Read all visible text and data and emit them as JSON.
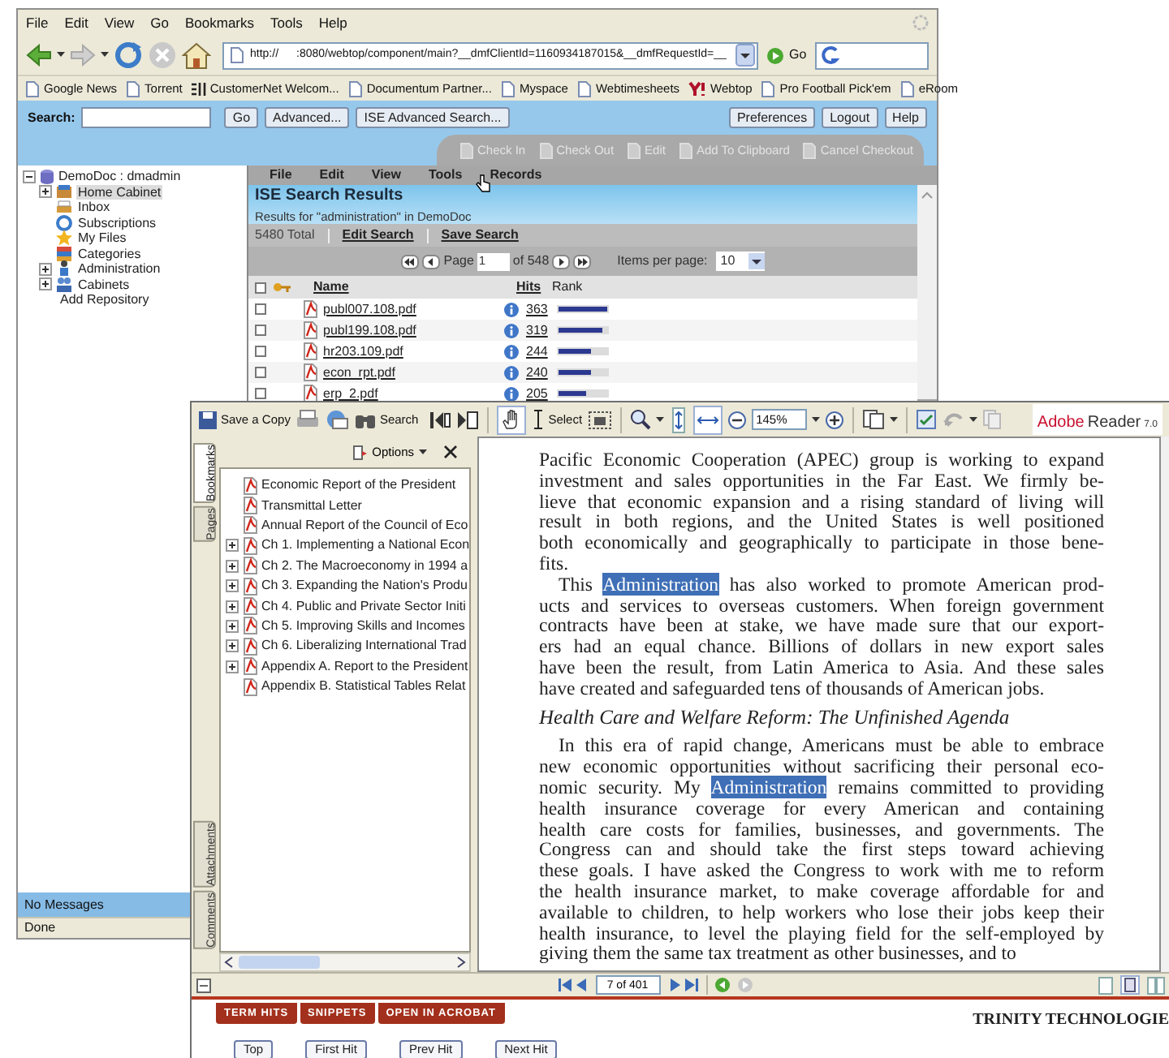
{
  "browser": {
    "menu": [
      "File",
      "Edit",
      "View",
      "Go",
      "Bookmarks",
      "Tools",
      "Help"
    ],
    "address": {
      "prefix": "http://",
      "value": ":8080/webtop/component/main?__dmfClientId=1160934187015&__dmfRequestId=__"
    },
    "go_button": "Go",
    "bookmarks": [
      {
        "label": "Google News",
        "kind": "page"
      },
      {
        "label": "Torrent",
        "kind": "page"
      },
      {
        "label": "CustomerNet Welcom...",
        "kind": "emc"
      },
      {
        "label": "Documentum Partner...",
        "kind": "page"
      },
      {
        "label": "Myspace",
        "kind": "page"
      },
      {
        "label": "Webtimesheets",
        "kind": "page"
      },
      {
        "label": "Webtop",
        "kind": "yahoo"
      },
      {
        "label": "Pro Football Pick'em",
        "kind": "page"
      },
      {
        "label": "eRoom",
        "kind": "page"
      }
    ],
    "status": "Done"
  },
  "webtop": {
    "search_label": "Search:",
    "search_buttons": [
      "Go",
      "Advanced...",
      "ISE Advanced Search..."
    ],
    "account_buttons": [
      "Preferences",
      "Logout",
      "Help"
    ],
    "actions": [
      {
        "label": "Check In",
        "disabled": true
      },
      {
        "label": "Check Out",
        "disabled": true
      },
      {
        "label": "Edit",
        "disabled": true
      },
      {
        "label": "Add To Clipboard",
        "disabled": true
      },
      {
        "label": "Cancel Checkout",
        "disabled": true
      }
    ],
    "tree": {
      "label": "DemoDoc : dmadmin",
      "expanded": true,
      "children": [
        {
          "label": "Home Cabinet",
          "expandable": true,
          "selected": true
        },
        {
          "label": "Inbox",
          "expandable": false,
          "selected": false
        },
        {
          "label": "Subscriptions",
          "expandable": false,
          "selected": false
        },
        {
          "label": "My Files",
          "expandable": false,
          "selected": false
        },
        {
          "label": "Categories",
          "expandable": false,
          "selected": false
        },
        {
          "label": "Administration",
          "expandable": true,
          "selected": false
        },
        {
          "label": "Cabinets",
          "expandable": true,
          "selected": false
        }
      ]
    },
    "add_repository": "Add Repository",
    "messages": "No Messages",
    "menu": [
      "File",
      "Edit",
      "View",
      "Tools",
      "Records"
    ],
    "results": {
      "title": "ISE Search Results",
      "subtitle": "Results for \"administration\" in DemoDoc",
      "total": "5480 Total",
      "links": [
        "Edit Search",
        "Save Search"
      ],
      "page_label": "Page",
      "page": "1",
      "page_of": "of 548",
      "per_page_label": "Items per page:",
      "per_page": "10",
      "columns": [
        "Name",
        "Hits",
        "Rank"
      ],
      "select_all": {
        "checked": false
      },
      "rows": [
        {
          "name": "publ007.108.pdf",
          "hits": "363",
          "level": 1.0,
          "checked": false
        },
        {
          "name": "publ199.108.pdf",
          "hits": "319",
          "level": 0.9,
          "checked": false
        },
        {
          "name": "hr203.109.pdf",
          "hits": "244",
          "level": 0.68,
          "checked": false
        },
        {
          "name": "econ_rpt.pdf",
          "hits": "240",
          "level": 0.66,
          "checked": false
        },
        {
          "name": "erp_2.pdf",
          "hits": "205",
          "level": 0.55,
          "checked": false
        }
      ]
    }
  },
  "reader": {
    "toolbar": {
      "save": "Save a Copy",
      "search": "Search",
      "select": "Select",
      "zoom": "145%"
    },
    "logo": {
      "brand": "Adobe",
      "product": "Reader",
      "version": "7.0"
    },
    "nav_tabs": [
      {
        "label": "Bookmarks",
        "selected": true
      },
      {
        "label": "Pages",
        "selected": false
      },
      {
        "label": "Attachments",
        "selected": false
      },
      {
        "label": "Comments",
        "selected": false
      }
    ],
    "options": "Options",
    "bookmarks": [
      {
        "label": "Economic Report of the President",
        "expandable": false
      },
      {
        "label": "Transmittal Letter",
        "expandable": false
      },
      {
        "label": "Annual Report of the Council of Eco",
        "expandable": false
      },
      {
        "label": "Ch 1. Implementing a National Econ",
        "expandable": true
      },
      {
        "label": "Ch 2. The Macroeconomy in 1994 a",
        "expandable": true
      },
      {
        "label": "Ch 3. Expanding the Nation's Produ",
        "expandable": true
      },
      {
        "label": "Ch 4. Public and Private Sector Initi",
        "expandable": true
      },
      {
        "label": "Ch 5. Improving Skills and Incomes",
        "expandable": true
      },
      {
        "label": "Ch 6. Liberalizing International Trad",
        "expandable": true
      },
      {
        "label": "Appendix A. Report to the President",
        "expandable": true
      },
      {
        "label": "Appendix B. Statistical Tables Relat",
        "expandable": false
      }
    ],
    "document": [
      {
        "kind": "text",
        "indent": false,
        "lines": [
          [
            {
              "text": "Pacific Economic Cooperation (APEC) group is working to expand",
              "highlighted": false
            }
          ],
          [
            {
              "text": "investment and sales opportunities in the Far East. We firmly be-",
              "highlighted": false
            }
          ],
          [
            {
              "text": "lieve that economic expansion and a rising standard of living will",
              "highlighted": false
            }
          ],
          [
            {
              "text": "result in both regions, and the United States is well positioned",
              "highlighted": false
            }
          ],
          [
            {
              "text": "both economically and geographically to participate in those bene-",
              "highlighted": false
            }
          ],
          [
            {
              "text": "fits.",
              "highlighted": false
            }
          ]
        ]
      },
      {
        "kind": "text",
        "indent": true,
        "lines": [
          [
            {
              "text": "This ",
              "highlighted": false
            },
            {
              "text": "Administration",
              "highlighted": true
            },
            {
              "text": " has also worked to promote American prod-",
              "highlighted": false
            }
          ],
          [
            {
              "text": "ucts and services to overseas customers. When foreign government",
              "highlighted": false
            }
          ],
          [
            {
              "text": "contracts have been at stake, we have made sure that our export-",
              "highlighted": false
            }
          ],
          [
            {
              "text": "ers had an equal chance. Billions of dollars in new export sales",
              "highlighted": false
            }
          ],
          [
            {
              "text": "have been the result, from Latin America to Asia. And these sales",
              "highlighted": false
            }
          ],
          [
            {
              "text": "have created and safeguarded tens of thousands of American jobs.",
              "highlighted": false
            }
          ]
        ]
      },
      {
        "kind": "heading",
        "text": "Health Care and Welfare Reform: The Unfinished Agenda"
      },
      {
        "kind": "text",
        "indent": true,
        "lines": [
          [
            {
              "text": "In this era of rapid change, Americans must be able to embrace",
              "highlighted": false
            }
          ],
          [
            {
              "text": "new economic opportunities without sacrificing their personal eco-",
              "highlighted": false
            }
          ],
          [
            {
              "text": "nomic security. My ",
              "highlighted": false
            },
            {
              "text": "Administration",
              "highlighted": true
            },
            {
              "text": " remains committed to providing",
              "highlighted": false
            }
          ],
          [
            {
              "text": "health insurance coverage for every American and containing",
              "highlighted": false
            }
          ],
          [
            {
              "text": "health care costs for families, businesses, and governments. The",
              "highlighted": false
            }
          ],
          [
            {
              "text": "Congress can and should take the first steps toward achieving",
              "highlighted": false
            }
          ],
          [
            {
              "text": "these goals. I have asked the Congress to work with me to reform",
              "highlighted": false
            }
          ],
          [
            {
              "text": "the health insurance market, to make coverage affordable for and",
              "highlighted": false
            }
          ],
          [
            {
              "text": "available to children, to help workers who lose their jobs keep their",
              "highlighted": false
            }
          ],
          [
            {
              "text": "health insurance, to level the playing field for the self-employed by",
              "highlighted": false
            }
          ],
          [
            {
              "text": "giving them the same tax treatment as other businesses, and to",
              "highlighted": false
            }
          ]
        ]
      }
    ],
    "page_field": "7 of 401",
    "term_tabs": [
      "TERM HITS",
      "SNIPPETS",
      "OPEN IN ACROBAT"
    ],
    "hit_buttons": [
      "Top",
      "First Hit",
      "Prev Hit",
      "Next Hit"
    ],
    "vendor": "TRINITY TECHNOLOGIE"
  }
}
